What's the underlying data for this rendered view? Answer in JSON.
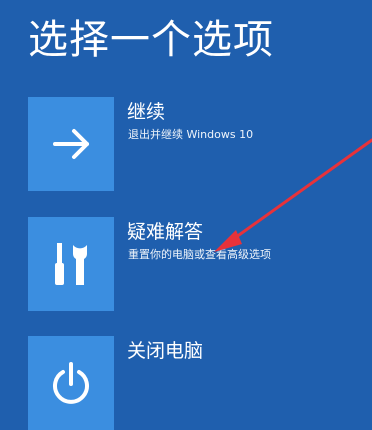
{
  "page": {
    "title": "选择一个选项"
  },
  "options": [
    {
      "title": "继续",
      "subtitle": "退出并继续 Windows 10",
      "icon": "arrow-right-icon"
    },
    {
      "title": "疑难解答",
      "subtitle": "重置你的电脑或查看高级选项",
      "icon": "tools-icon"
    },
    {
      "title": "关闭电脑",
      "subtitle": "",
      "icon": "power-icon"
    }
  ],
  "annotation": {
    "icon": "red-pointer-arrow",
    "color": "#e8323a"
  },
  "colors": {
    "background": "#1f5fae",
    "tile": "#3b8ee0",
    "text": "#ffffff"
  }
}
